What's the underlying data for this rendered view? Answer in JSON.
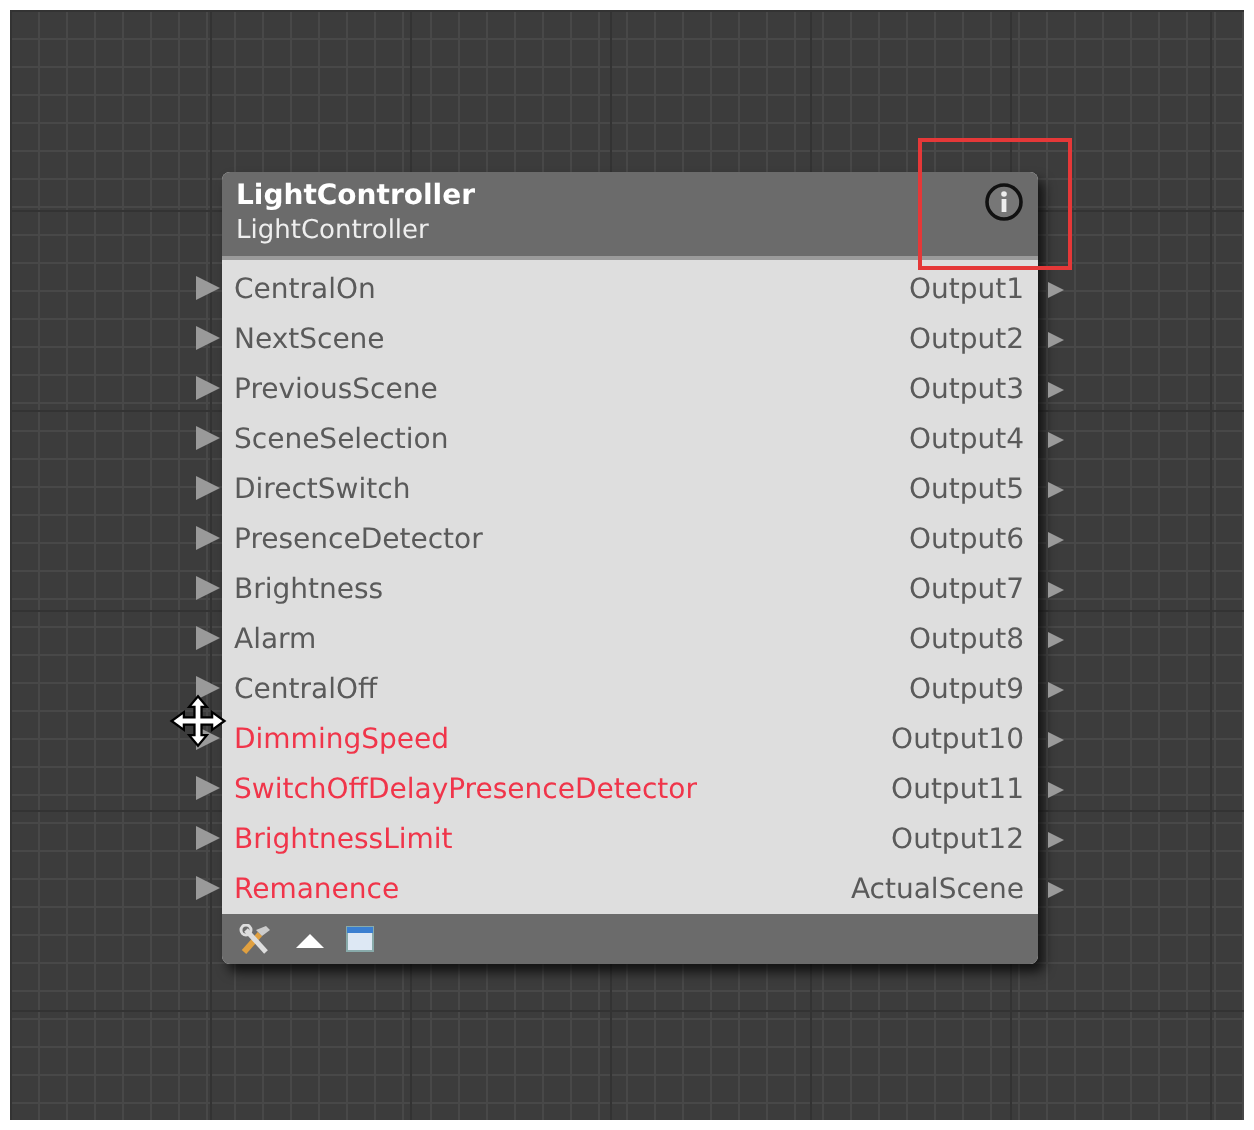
{
  "node": {
    "title": "LightController",
    "subtitle": "LightController",
    "inputs": [
      {
        "label": "CentralOn",
        "missing": false
      },
      {
        "label": "NextScene",
        "missing": false
      },
      {
        "label": "PreviousScene",
        "missing": false
      },
      {
        "label": "SceneSelection",
        "missing": false
      },
      {
        "label": "DirectSwitch",
        "missing": false
      },
      {
        "label": "PresenceDetector",
        "missing": false
      },
      {
        "label": "Brightness",
        "missing": false
      },
      {
        "label": "Alarm",
        "missing": false
      },
      {
        "label": "CentralOff",
        "missing": false
      },
      {
        "label": "DimmingSpeed",
        "missing": true
      },
      {
        "label": "SwitchOffDelayPresenceDetector",
        "missing": true
      },
      {
        "label": "BrightnessLimit",
        "missing": true
      },
      {
        "label": "Remanence",
        "missing": true
      }
    ],
    "outputs": [
      "Output1",
      "Output2",
      "Output3",
      "Output4",
      "Output5",
      "Output6",
      "Output7",
      "Output8",
      "Output9",
      "Output10",
      "Output11",
      "Output12",
      "ActualScene"
    ]
  }
}
